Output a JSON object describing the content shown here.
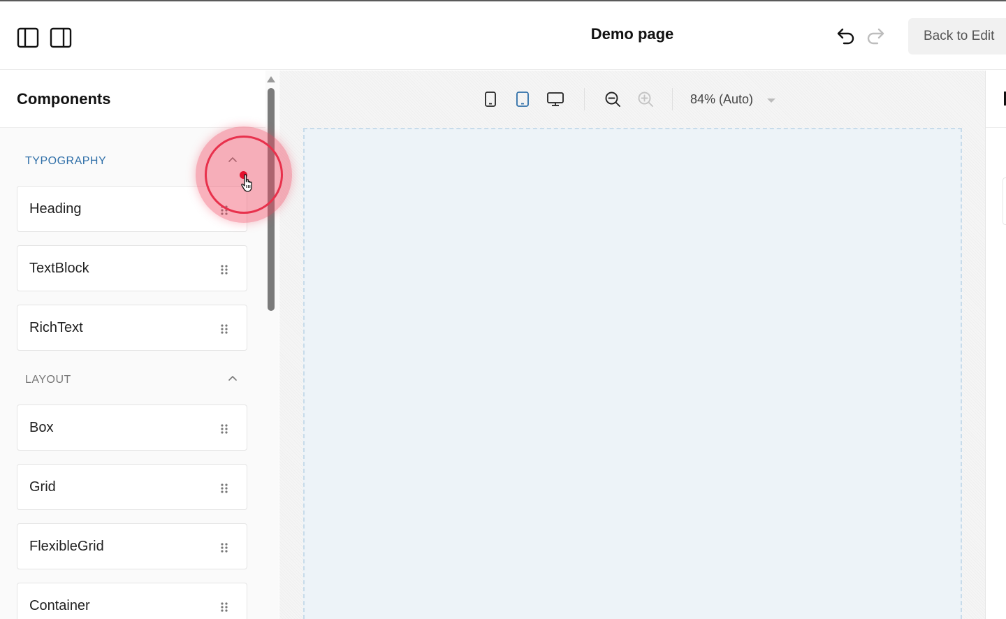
{
  "header": {
    "title": "Demo page",
    "back_label": "Back to Edit"
  },
  "sidebar": {
    "title": "Components",
    "sections": [
      {
        "label": "TYPOGRAPHY",
        "items": [
          "Heading",
          "TextBlock",
          "RichText"
        ]
      },
      {
        "label": "LAYOUT",
        "items": [
          "Box",
          "Grid",
          "FlexibleGrid",
          "Container"
        ]
      }
    ]
  },
  "toolbar": {
    "zoom_label": "84% (Auto)",
    "active_device": "tablet"
  },
  "icons": {
    "left_panel_toggle": "sidebar-left-icon",
    "right_panel_toggle": "sidebar-right-icon",
    "undo": "undo-icon",
    "redo": "redo-icon",
    "mobile": "mobile-icon",
    "tablet": "tablet-icon",
    "desktop": "desktop-icon",
    "zoom_out": "zoom-out-icon",
    "zoom_in": "zoom-in-icon",
    "collapse": "chevron-up-icon",
    "drag": "drag-handle-icon"
  },
  "colors": {
    "accent": "#2f6fa8",
    "canvas_frame": "#edf3f8",
    "click_indicator": "#e3102c"
  }
}
